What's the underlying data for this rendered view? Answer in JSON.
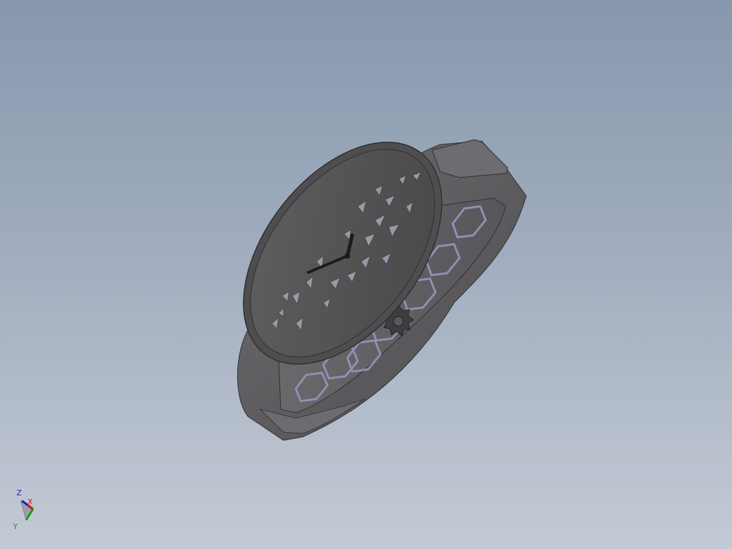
{
  "viewport": {
    "background_top": "#8797ad",
    "background_bottom": "#c4cad5"
  },
  "model": {
    "name": "wristwatch-3d-model",
    "view": "isometric",
    "body_color": "#5f5d5f",
    "bezel_color": "#4e4d50",
    "dial_color": "#535353",
    "highlight_color": "#8e92b2",
    "glass_cut_color": "#a2a7b8"
  },
  "triad": {
    "labels": {
      "z": "Z",
      "x": "X",
      "y": "Y"
    },
    "colors": {
      "z": "#1a1acc",
      "x": "#cc1a1a",
      "y": "#12a012"
    }
  }
}
